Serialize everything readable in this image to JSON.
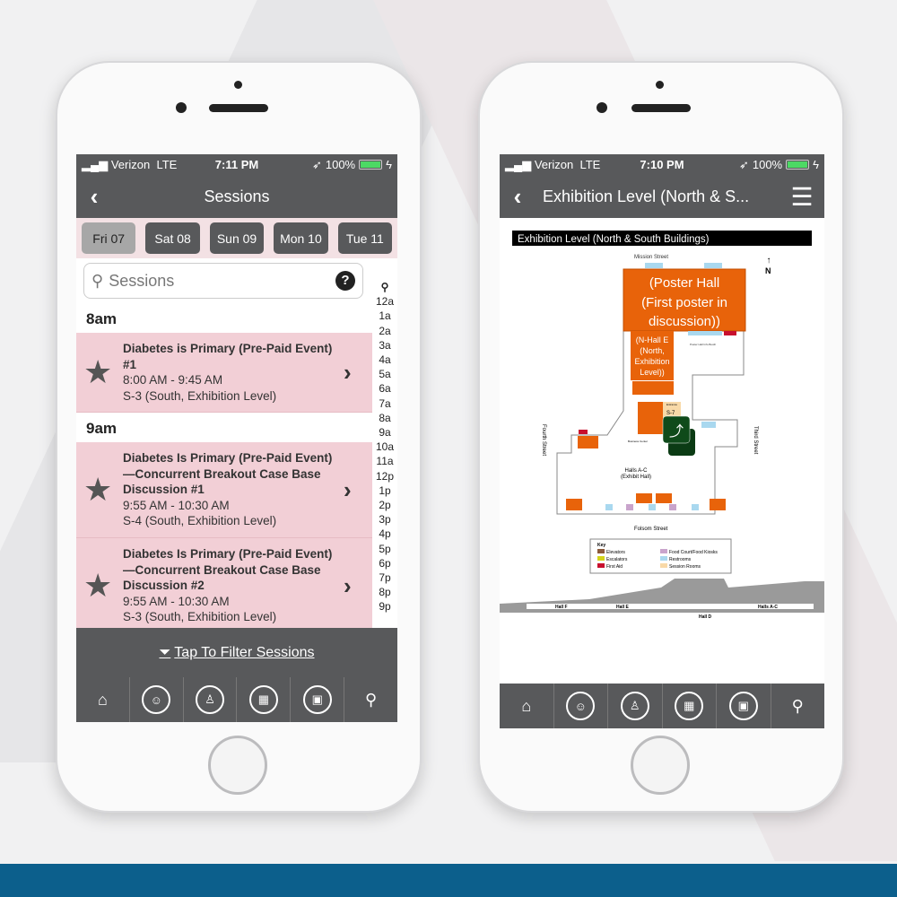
{
  "colors": {
    "nav": "#58595b",
    "session_bg": "#f2cfd6",
    "days_bg": "#f3e1e4",
    "map_orange": "#e8630a",
    "brand_bar": "#0c5f8c"
  },
  "status_left": {
    "carrier": "Verizon",
    "network": "LTE",
    "time": "7:11 PM",
    "battery": "100%"
  },
  "status_right": {
    "carrier": "Verizon",
    "network": "LTE",
    "time": "7:10 PM",
    "battery": "100%"
  },
  "sessions": {
    "title": "Sessions",
    "days": [
      {
        "label": "Fri 07",
        "selected": true
      },
      {
        "label": "Sat 08"
      },
      {
        "label": "Sun 09"
      },
      {
        "label": "Mon 10"
      },
      {
        "label": "Tue 11"
      }
    ],
    "search_placeholder": "Sessions",
    "groups": [
      {
        "time": "8am",
        "items": [
          {
            "title": "Diabetes is Primary (Pre-Paid Event) #1",
            "time": "8:00 AM - 9:45 AM",
            "room": "S-3 (South, Exhibition Level)"
          }
        ]
      },
      {
        "time": "9am",
        "items": [
          {
            "title": "Diabetes Is Primary (Pre-Paid Event)—Concurrent Breakout Case Base Discussion #1",
            "time": "9:55 AM - 10:30 AM",
            "room": "S-4 (South, Exhibition Level)"
          },
          {
            "title": "Diabetes Is Primary (Pre-Paid Event)—Concurrent Breakout Case Base Discussion #2",
            "time": "9:55 AM - 10:30 AM",
            "room": "S-3 (South, Exhibition Level)"
          }
        ]
      }
    ],
    "index": [
      "12a",
      "1a",
      "2a",
      "3a",
      "4a",
      "5a",
      "6a",
      "7a",
      "8a",
      "9a",
      "10a",
      "11a",
      "12p",
      "1p",
      "2p",
      "3p",
      "4p",
      "5p",
      "6p",
      "7p",
      "8p",
      "9p"
    ],
    "filter_label": "Tap To Filter Sessions"
  },
  "map": {
    "title": "Exhibition Level (North & S...",
    "banner": "Exhibition Level (North & South Buildings)",
    "north": "N",
    "streets": {
      "mission": "Mission Street",
      "fourth": "Fourth Street",
      "third": "Third Street",
      "folsom": "Folsom Street"
    },
    "poster_hall": [
      "(Poster Hall",
      "(First poster in",
      "discussion))"
    ],
    "n_hall_e": [
      "(N-Hall E",
      "(North,",
      "Exhibition",
      "Level))"
    ],
    "poster_booth": "Poster Hall Info Booth",
    "entrance": "Entrance",
    "s7": "S-7",
    "business": "Business Center",
    "halls": [
      "Halls A-C",
      "(Exhibit Hall)"
    ],
    "key": {
      "title": "Key",
      "items": [
        {
          "label": "Elevators",
          "color": "#8b5a3c"
        },
        {
          "label": "Escalators",
          "color": "#d4d41a"
        },
        {
          "label": "First Aid",
          "color": "#c8102e"
        },
        {
          "label": "Food Court/Food Kiosks",
          "color": "#c9a4cc"
        },
        {
          "label": "Restrooms",
          "color": "#a9d8ef"
        },
        {
          "label": "Session Rooms",
          "color": "#f8d9a8"
        }
      ]
    },
    "section": {
      "hall_f": "Hall F",
      "hall_e": "Hall E",
      "halls_ac": "Halls A-C",
      "hall_d": "Hall D"
    }
  },
  "tabbar": [
    "home-icon",
    "attendees-icon",
    "presenter-icon",
    "exhibits-icon",
    "kiosk-icon",
    "search-icon"
  ]
}
